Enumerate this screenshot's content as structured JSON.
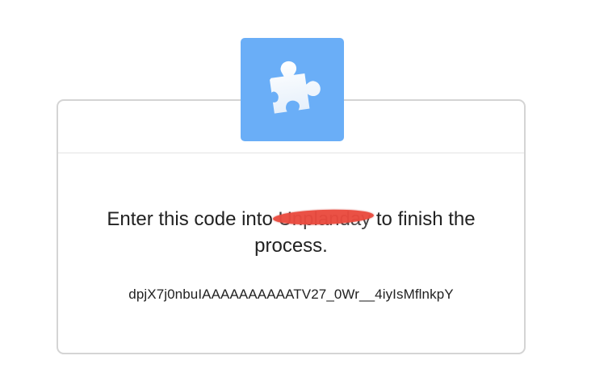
{
  "app_icon": {
    "name": "puzzle-icon",
    "color": "#6aaef7"
  },
  "message": {
    "before": "Enter this code into ",
    "redacted": "Unplanday",
    "after": " to finish the process."
  },
  "code": "dpjX7j0nbuIAAAAAAAAAATV27_0Wr__4iyIsMflnkpY"
}
